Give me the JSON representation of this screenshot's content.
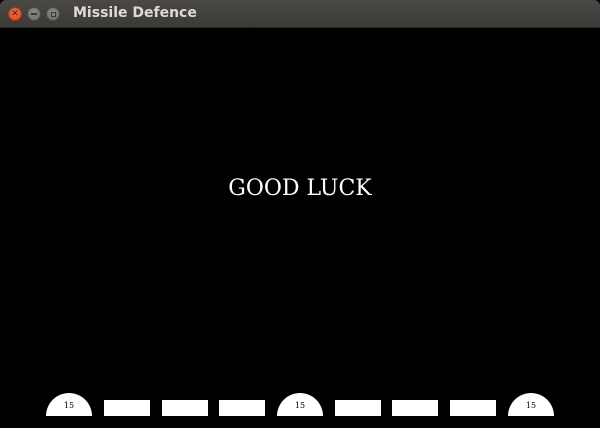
{
  "window": {
    "title": "Missile Defence"
  },
  "game": {
    "message": "GOOD LUCK",
    "bases": [
      {
        "ammo": "15"
      },
      {
        "ammo": "15"
      },
      {
        "ammo": "15"
      }
    ],
    "cities_remaining": 6
  },
  "colors": {
    "background": "#000000",
    "foreground": "#ffffff",
    "titlebar": "#3c3b37",
    "close_button": "#e95420"
  },
  "icons": {
    "close": "close-icon",
    "minimize": "minimize-icon",
    "maximize": "maximize-icon"
  }
}
